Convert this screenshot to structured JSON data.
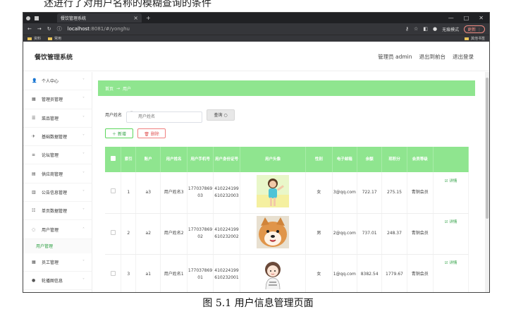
{
  "top_caption": "述进行了对用户名称的模糊查询的条件",
  "browser": {
    "tab_title": "餐饮管理系统",
    "tab_close": "×",
    "tab_new": "+",
    "url_host": "localhost",
    "url_path": ":8081/#/yonghu",
    "incognito_label": "无痕模式",
    "update_label": "更新 ⋮",
    "bookmarks": [
      "资料",
      "常用"
    ],
    "bookmarks_right": "其他书签"
  },
  "app": {
    "title": "餐饮管理系统",
    "header_links": [
      "管理员 admin",
      "退出到前台",
      "退出登录"
    ]
  },
  "sidebar": {
    "items": [
      {
        "label": "个人中心",
        "icon": "person-icon",
        "glyph": "👤"
      },
      {
        "label": "管理员管理",
        "icon": "admin-icon",
        "glyph": "▦"
      },
      {
        "label": "菜品管理",
        "icon": "dish-icon",
        "glyph": "☰"
      },
      {
        "label": "基础数据管理",
        "icon": "send-icon",
        "glyph": "✈"
      },
      {
        "label": "论坛管理",
        "icon": "forum-icon",
        "glyph": "≡"
      },
      {
        "label": "供应商管理",
        "icon": "supplier-icon",
        "glyph": "▤"
      },
      {
        "label": "公告信息管理",
        "icon": "notice-icon",
        "glyph": "▥"
      },
      {
        "label": "单页数据管理",
        "icon": "page-icon",
        "glyph": "☷"
      },
      {
        "label": "用户管理",
        "icon": "user-icon",
        "glyph": "◌",
        "expanded": true
      },
      {
        "label": "员工管理",
        "icon": "staff-icon",
        "glyph": "▦"
      },
      {
        "label": "轮播图信息",
        "icon": "carousel-icon",
        "glyph": "●"
      }
    ],
    "active_sub": "用户管理"
  },
  "breadcrumb": [
    "首页",
    "→",
    "用户"
  ],
  "search": {
    "label": "用户姓名",
    "placeholder": "用户姓名",
    "button": "查询 ○"
  },
  "actions": {
    "add": "＋ 新增",
    "delete": "🗑 删除"
  },
  "table": {
    "headers": [
      "",
      "索引",
      "账户",
      "用户姓名",
      "用户手机号",
      "用户身份证号",
      "用户头像",
      "性别",
      "电子邮箱",
      "余额",
      "现积分",
      "会员等级",
      ""
    ],
    "rows": [
      {
        "index": "1",
        "account": "a3",
        "name": "用户姓名3",
        "phone": "17703786903",
        "idcard": "410224199610232003",
        "avatar": "girl-photo",
        "gender": "女",
        "email": "3@qq.com",
        "balance": "722.17",
        "points": "275.15",
        "level": "青铜会员",
        "action": "☑ 详情"
      },
      {
        "index": "2",
        "account": "a2",
        "name": "用户姓名2",
        "phone": "17703786902",
        "idcard": "410224199610232002",
        "avatar": "dog-photo",
        "gender": "男",
        "email": "2@qq.com",
        "balance": "737.01",
        "points": "248.37",
        "level": "青铜会员",
        "action": "☑ 详情"
      },
      {
        "index": "3",
        "account": "a1",
        "name": "用户姓名1",
        "phone": "17703786901",
        "idcard": "410224199610232001",
        "avatar": "cartoon-girl",
        "gender": "女",
        "email": "1@qq.com",
        "balance": "8382.54",
        "points": "1779.67",
        "level": "青铜会员",
        "action": "☑ 详情"
      }
    ]
  },
  "figure_caption": "图 5.1  用户信息管理页面",
  "colors": {
    "accent": "#8fe58f",
    "link": "#2ea043",
    "danger": "#e05555"
  }
}
